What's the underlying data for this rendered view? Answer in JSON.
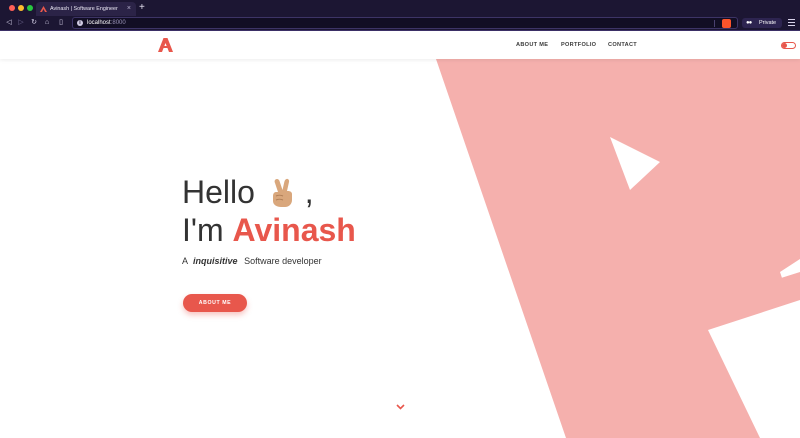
{
  "browser": {
    "tab_title": "Avinash | Software Engineer",
    "tab_close": "×",
    "new_tab": "+",
    "url_host": "localhost",
    "url_port": ":8000",
    "info_icon": "i",
    "private_label": "Private",
    "private_icon": "glasses-icon",
    "nav_icons": [
      "back-icon",
      "forward-icon",
      "reload-icon",
      "home-icon",
      "bookmark-icon"
    ]
  },
  "site": {
    "nav": {
      "about": "ABOUT ME",
      "portfolio": "PORTFOLIO",
      "contact": "CONTACT"
    },
    "hero": {
      "greeting": "Hello",
      "greeting_suffix": ",",
      "intro": "I'm",
      "name": "Avinash",
      "tagline_prefix": "A",
      "tagline_emphasis": "inquisitive",
      "tagline_suffix": "Software developer",
      "cta_label": "ABOUT ME"
    },
    "colors": {
      "accent": "#e8574c",
      "shape": "#f5b0ad",
      "chrome": "#1c1633"
    }
  }
}
